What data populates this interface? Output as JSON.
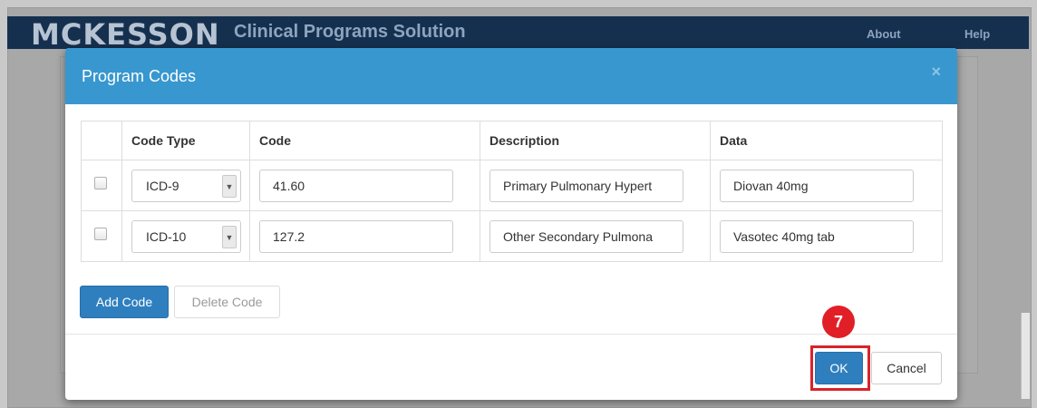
{
  "app": {
    "brand": "MCKESSON",
    "product": "Clinical Programs Solution",
    "nav": {
      "about": "About",
      "help": "Help"
    }
  },
  "modal": {
    "title": "Program Codes",
    "close_glyph": "×",
    "columns": [
      "Code Type",
      "Code",
      "Description",
      "Data"
    ],
    "rows": [
      {
        "checked": false,
        "code_type": "ICD-9",
        "code": "41.60",
        "description": "Primary Pulmonary Hypert",
        "data": "Diovan 40mg"
      },
      {
        "checked": false,
        "code_type": "ICD-10",
        "code": "127.2",
        "description": "Other Secondary Pulmona",
        "data": "Vasotec 40mg tab"
      }
    ],
    "add_code_label": "Add Code",
    "delete_code_label": "Delete Code",
    "ok_label": "OK",
    "cancel_label": "Cancel"
  },
  "annotation": {
    "step_number": "7",
    "highlight_color": "#d9232a"
  },
  "colors": {
    "header_bg": "#15304f",
    "modal_header_bg": "#3897cf",
    "primary_button": "#2f7fbf"
  },
  "icons": {
    "select_arrow": "caret-down-icon",
    "close": "close-icon"
  }
}
